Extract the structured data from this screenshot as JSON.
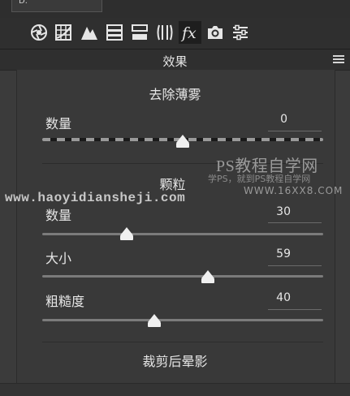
{
  "top_bar": {
    "tab_label": "D."
  },
  "toolbar": {
    "tools": [
      {
        "name": "aperture-icon",
        "active": false
      },
      {
        "name": "grid-icon",
        "active": false
      },
      {
        "name": "mountain-icon",
        "active": false
      },
      {
        "name": "split-toning-icon",
        "active": false
      },
      {
        "name": "hsl-bars-icon",
        "active": false
      },
      {
        "name": "lens-correction-icon",
        "active": false
      },
      {
        "name": "fx-icon",
        "active": true
      },
      {
        "name": "camera-icon",
        "active": false
      },
      {
        "name": "sliders-icon",
        "active": false
      }
    ]
  },
  "section": {
    "title": "效果"
  },
  "dehaze": {
    "title": "去除薄雾",
    "amount": {
      "label": "数量",
      "value": "0",
      "position_pct": 50
    }
  },
  "grain": {
    "title": "颗粒",
    "amount": {
      "label": "数量",
      "value": "30",
      "position_pct": 30
    },
    "size": {
      "label": "大小",
      "value": "59",
      "position_pct": 59
    },
    "roughness": {
      "label": "粗糙度",
      "value": "40",
      "position_pct": 40
    }
  },
  "vignette": {
    "title": "裁剪后晕影"
  },
  "watermarks": {
    "ps_logo": "PS教程自学网",
    "ps_subtitle": "学PS，就到PS教程自学网",
    "site_url_big": "www.haoyidiansheji.com",
    "site_url_right": "WWW.16XX8.COM"
  },
  "colors": {
    "background": "#3b3b3b",
    "toolbar": "#2f2f2f",
    "text": "#e2e2e2"
  }
}
